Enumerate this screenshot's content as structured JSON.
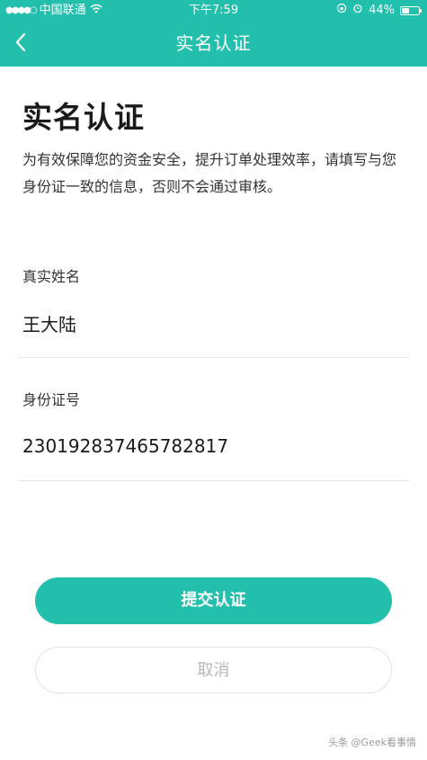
{
  "status_bar": {
    "carrier": "中国联通",
    "time": "下午7:59",
    "battery_percent": "44%",
    "battery_level": 0.44
  },
  "nav": {
    "title": "实名认证"
  },
  "page": {
    "title": "实名认证",
    "intro": "为有效保障您的资金安全，提升订单处理效率，请填写与您身份证一致的信息，否则不会通过审核。"
  },
  "form": {
    "name_label": "真实姓名",
    "name_value": "王大陆",
    "id_label": "身份证号",
    "id_value": "230192837465782817"
  },
  "actions": {
    "submit_label": "提交认证",
    "cancel_label": "取消"
  },
  "watermark": "头条 @Geek看事情"
}
